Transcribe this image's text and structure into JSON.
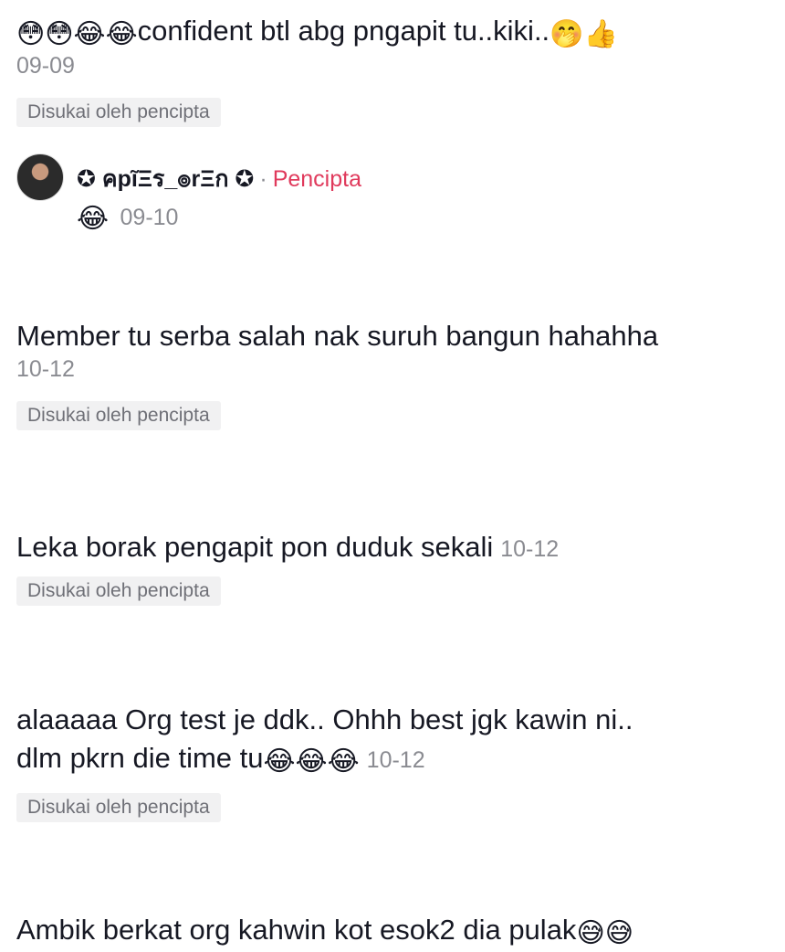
{
  "comments": [
    {
      "text": "confident btl abg pngapit tu..kiki..",
      "emoji_before": "😳😳😂😂",
      "emoji_after": "🤭👍",
      "date": "09-09",
      "liked": "Disukai oleh pencipta"
    },
    {
      "text": "Member tu serba salah nak suruh bangun hahahha",
      "date": "10-12",
      "liked": "Disukai oleh pencipta"
    },
    {
      "text": "Leka borak pengapit pon duduk sekali",
      "date": "10-12",
      "liked": "Disukai oleh pencipta"
    },
    {
      "text_line1": "alaaaaa Org test je ddk.. Ohhh best jgk kawin ni..",
      "text_line2": "dlm pkrn die time tu",
      "emoji": "😂😂😂",
      "date": "10-12",
      "liked": "Disukai oleh pencipta"
    },
    {
      "text": "Ambik berkat org kahwin kot esok2 dia pulak",
      "emoji": "😅😅"
    }
  ],
  "reply": {
    "username": "✪ คpĩΞร_๏rΞก ✪",
    "separator": "·",
    "creator_label": "Pencipta",
    "emoji": "😂",
    "date": "09-10"
  }
}
